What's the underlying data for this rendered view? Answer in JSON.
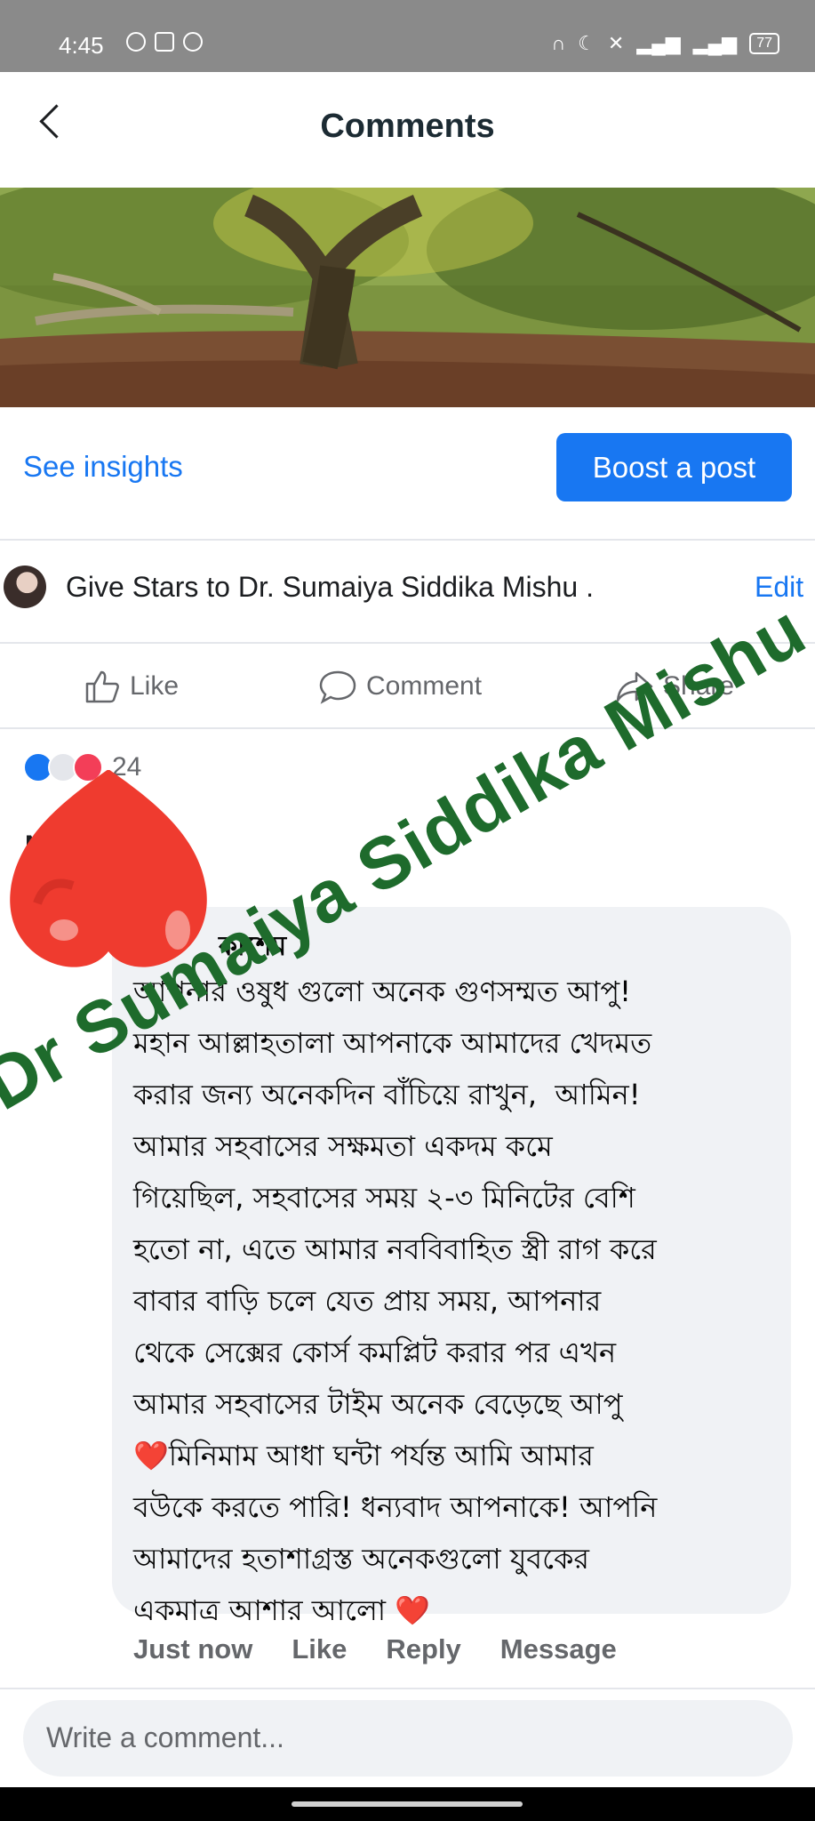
{
  "status_bar": {
    "time": "4:45",
    "battery": "77"
  },
  "header": {
    "title": "Comments"
  },
  "post_actions": {
    "insights": "See insights",
    "boost": "Boost a post"
  },
  "page_row": {
    "name": "Give Stars to Dr. Sumaiya Siddika Mishu .",
    "edit": "Edit"
  },
  "actions": {
    "like": "Like",
    "comment": "Comment",
    "share": "Share"
  },
  "reactions": {
    "count": "24"
  },
  "comment": {
    "name_fragment": "N",
    "author": "কাশেম",
    "text": "আপনার ওষুধ গুলো অনেক গুণসম্মত আপু!\nমহান আল্লাহতালা আপনাকে আমাদের খেদমত\nকরার জন্য অনেকদিন বাঁচিয়ে রাখুন,  আমিন!\nআমার সহবাসের সক্ষমতা একদম কমে\nগিয়েছিল, সহবাসের সময় ২-৩ মিনিটের বেশি\nহতো না, এতে আমার নববিবাহিত স্ত্রী রাগ করে\nবাবার বাড়ি চলে যেত প্রায় সময়, আপনার\nথেকে সেক্সের কোর্স কমপ্লিট করার পর এখন\nআমার সহবাসের টাইম অনেক বেড়েছে আপু\n❤️মিনিমাম আধা ঘন্টা পর্যন্ত আমি আমার\nবউকে করতে পারি! ধন্যবাদ আপনাকে! আপনি\nআমাদের হতাশাগ্রস্ত অনেকগুলো যুবকের\nএকমাত্র আশার আলো ❤️",
    "time": "Just now",
    "like": "Like",
    "reply": "Reply",
    "message": "Message"
  },
  "composer": {
    "placeholder": "Write a comment..."
  },
  "watermark": "Dr Sumaiya Siddika Mishu",
  "colors": {
    "accent": "#1877f2",
    "watermark": "#1e6b2c",
    "heart": "#f03c32"
  }
}
